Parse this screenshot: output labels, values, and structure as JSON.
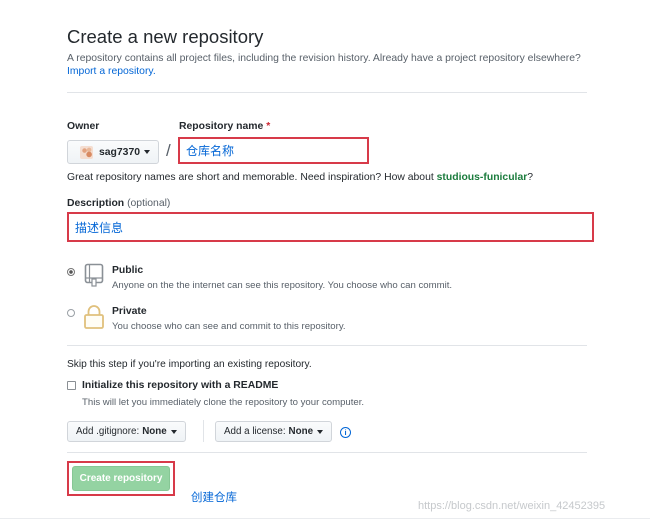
{
  "header": {
    "title": "Create a new repository",
    "subtitle": "A repository contains all project files, including the revision history. Already have a project repository elsewhere?",
    "import_link": "Import a repository."
  },
  "owner": {
    "label": "Owner",
    "value": "sag7370"
  },
  "repo_name": {
    "label": "Repository name",
    "required_mark": "*",
    "value": "仓库名称"
  },
  "slash": "/",
  "hint": {
    "prefix": "Great repository names are short and memorable. Need inspiration? How about ",
    "suggestion": "studious-funicular",
    "suffix": "?"
  },
  "description": {
    "label": "Description",
    "optional_text": "(optional)",
    "value": "描述信息"
  },
  "visibility": {
    "public": {
      "title": "Public",
      "desc": "Anyone on the the internet can see this repository. You choose who can commit.",
      "selected": true
    },
    "private": {
      "title": "Private",
      "desc": "You choose who can see and commit to this repository.",
      "selected": false
    }
  },
  "init": {
    "skip_text": "Skip this step if you're importing an existing repository.",
    "readme_label": "Initialize this repository with a README",
    "readme_desc": "This will let you immediately clone the repository to your computer.",
    "readme_checked": false
  },
  "gitignore": {
    "label": "Add .gitignore:",
    "value": "None"
  },
  "license": {
    "label": "Add a license:",
    "value": "None"
  },
  "info_icon_glyph": "i",
  "create_button": "Create repository",
  "annotation": "创建仓库",
  "watermark": "https://blog.csdn.net/weixin_42452395",
  "colors": {
    "link": "#0366d6",
    "highlight_border": "#d73a49",
    "create_button_bg": "#94d3a2",
    "suggestion": "#1b7c3d"
  },
  "icons": {
    "public": "repo-icon",
    "private": "lock-icon",
    "info": "info-icon"
  }
}
